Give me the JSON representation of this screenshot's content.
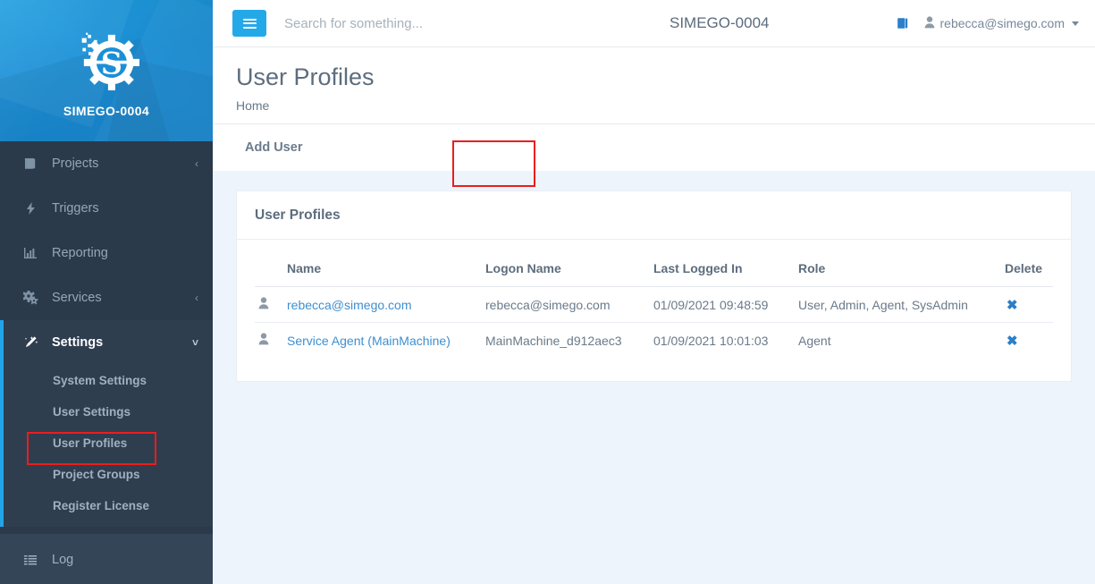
{
  "brand": {
    "name": "SIMEGO-0004",
    "logo_icon": "gear-s-logo-icon"
  },
  "sidebar": {
    "items": [
      {
        "label": "Projects",
        "icon": "book-icon",
        "chevron": "‹",
        "active": false
      },
      {
        "label": "Triggers",
        "icon": "bolt-icon",
        "chevron": "",
        "active": false
      },
      {
        "label": "Reporting",
        "icon": "bar-chart-icon",
        "chevron": "",
        "active": false
      },
      {
        "label": "Services",
        "icon": "gears-icon",
        "chevron": "‹",
        "active": false
      },
      {
        "label": "Settings",
        "icon": "magic-wand-icon",
        "chevron": "˅",
        "active": true
      }
    ],
    "subitems": [
      {
        "label": "System Settings",
        "active": false
      },
      {
        "label": "User Settings",
        "active": false
      },
      {
        "label": "User Profiles",
        "active": true
      },
      {
        "label": "Project Groups",
        "active": false
      },
      {
        "label": "Register License",
        "active": false
      }
    ],
    "bottom": {
      "label": "Log",
      "icon": "list-icon"
    },
    "accent_color": "#22a5e8",
    "bg_color": "#2b3a4a"
  },
  "topbar": {
    "menu_toggle_icon": "hamburger-icon",
    "search_placeholder": "Search for something...",
    "search_value": "",
    "title": "SIMEGO-0004",
    "book_icon": "book-icon",
    "user_icon": "user-icon",
    "user_email": "rebecca@simego.com"
  },
  "page": {
    "title": "User Profiles",
    "breadcrumb": "Home",
    "add_user_label": "Add User"
  },
  "card": {
    "title": "User Profiles",
    "columns": [
      "Name",
      "Logon Name",
      "Last Logged In",
      "Role",
      "Delete"
    ],
    "rows": [
      {
        "name": "rebecca@simego.com",
        "logon": "rebecca@simego.com",
        "last_logged_in": "01/09/2021 09:48:59",
        "role": "User, Admin, Agent, SysAdmin",
        "delete_icon": "✖"
      },
      {
        "name": "Service Agent (MainMachine)",
        "logon": "MainMachine_d912aec3",
        "last_logged_in": "01/09/2021 10:01:03",
        "role": "Agent",
        "delete_icon": "✖"
      }
    ]
  },
  "annotations": {
    "color": "#ee1c1c",
    "boxes": [
      "user-profiles-sidebar-item",
      "add-user-button"
    ]
  }
}
